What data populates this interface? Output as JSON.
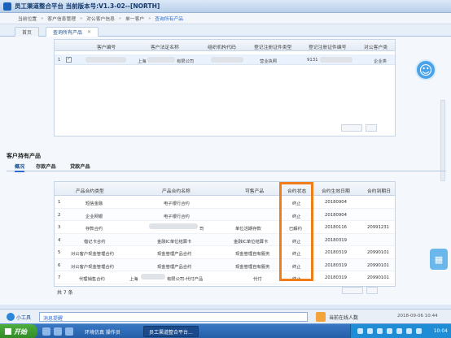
{
  "window": {
    "title": "员工渠道整合平台 当前版本号:V1.3-02--[NORTH]"
  },
  "breadcrumb": [
    "当前位置",
    "客户信息管理",
    "对公客户信息",
    "单一客户",
    "查询所有产品"
  ],
  "tabs": [
    {
      "label": "首页"
    },
    {
      "label": "查询所有产品"
    }
  ],
  "customer_grid": {
    "headers": [
      "客户编号",
      "客户法定名称",
      "组织机构代码",
      "登记注册证件类型",
      "登记注册证件编号",
      "对公客户类"
    ],
    "rows": [
      {
        "index": "1",
        "name_suffix": "有限公司",
        "location": "上海",
        "org_code_prefix": "",
        "cert_type": "营业执照",
        "cert_no_prefix": "9131",
        "category": "企业类"
      }
    ]
  },
  "section": {
    "title": "客户持有产品",
    "tabs": [
      "概况",
      "存款产品",
      "贷款产品"
    ]
  },
  "product_grid": {
    "headers": [
      "产品合约类型",
      "产品合约名称",
      "可售产品",
      "合约状态",
      "合约生效日期",
      "合约到期日"
    ],
    "rows": [
      {
        "no": "1",
        "type": "短信金融",
        "name": "电子银行合约",
        "sellable": "",
        "status": "终止",
        "start": "20180904",
        "end": ""
      },
      {
        "no": "2",
        "type": "企业网银",
        "name": "电子银行合约",
        "sellable": "",
        "status": "终止",
        "start": "20180904",
        "end": ""
      },
      {
        "no": "3",
        "type": "存款合约",
        "name": "司",
        "sellable": "单位活期存款",
        "status": "已解约",
        "start": "20180116",
        "end": "20991231"
      },
      {
        "no": "4",
        "type": "借记卡合约",
        "name": "金融IC单位结算卡",
        "sellable": "金融IC单位结算卡",
        "status": "终止",
        "start": "20180319",
        "end": ""
      },
      {
        "no": "5",
        "type": "对公客户现金管理合约",
        "name": "现金管理产品合约",
        "sellable": "现金管理自有服务",
        "status": "终止",
        "start": "20180319",
        "end": "20990101"
      },
      {
        "no": "6",
        "type": "对公客户现金管理合约",
        "name": "现金管理产品合约",
        "sellable": "现金管理自有服务",
        "status": "终止",
        "start": "20180319",
        "end": "20990101"
      },
      {
        "no": "7",
        "type": "代理销售合约",
        "name": "有限公司-代付产品",
        "location": "上海",
        "sellable": "代付",
        "status": "终止",
        "start": "20180319",
        "end": "20990101"
      }
    ],
    "total_label": "共 7 条"
  },
  "bottom_toolbar": {
    "label": "小工具",
    "input_value": "消息提醒",
    "online_label": "当前在线人数",
    "datetime": "2018-09-06 10:44"
  },
  "taskbar": {
    "start_label": "开始",
    "tasks": [
      "环境仿真 操作员",
      "员工渠道整合平台..."
    ],
    "clock": "10:04"
  },
  "colors": {
    "highlight": "#f07d1a",
    "accent": "#2a6acb"
  }
}
